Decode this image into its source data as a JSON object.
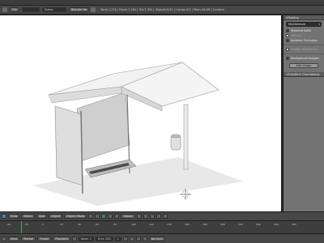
{
  "topbar": {
    "title": "Blender [...]"
  },
  "info_header": {
    "scene_field": "Scene",
    "render_engine": "Blender Render",
    "stats": "Verts:1.23k | Faces:1.16k | Tris:2.32k | Objects:0/11 | Lamps:0/1 | Mem:16.4M | Camera"
  },
  "properties": {
    "shading_panel": "Shading",
    "shading_mode": "Multitexture",
    "options": [
      {
        "label": "Textured Solid",
        "checked": true,
        "dim": false
      },
      {
        "label": "Matcap",
        "checked": false,
        "dim": true
      },
      {
        "label": "Ambient Occlusion",
        "checked": true,
        "dim": false
      },
      {
        "label": "Hidden Wireframe",
        "checked": false,
        "dim": true
      }
    ],
    "background_images": {
      "label": "Background Images",
      "checked": true
    },
    "add_image_button": "Add Image",
    "transform_panel": "Transform Orientations"
  },
  "view_header": {
    "view": "View",
    "select": "Select",
    "add": "Add",
    "object": "Object",
    "mode": "Object Mode",
    "pivot": "Global"
  },
  "timeline": {
    "ticks": [
      "-40",
      "-20",
      "0",
      "20",
      "40",
      "60",
      "80",
      "100",
      "120",
      "140",
      "160",
      "180",
      "200",
      "220",
      "240",
      "260",
      "280"
    ],
    "current_frame": 1
  },
  "timeline_header": {
    "view": "View",
    "marker": "Marker",
    "frame": "Frame",
    "playback": "Playback",
    "start": "Start: 1",
    "end": "End: 250",
    "frame_field": "1",
    "sync": "No Sync"
  },
  "colors": {
    "viewport_bg": "#ffffff",
    "panel_bg": "#737373",
    "header_bg": "#474747",
    "frame_marker": "#5aa05a"
  }
}
